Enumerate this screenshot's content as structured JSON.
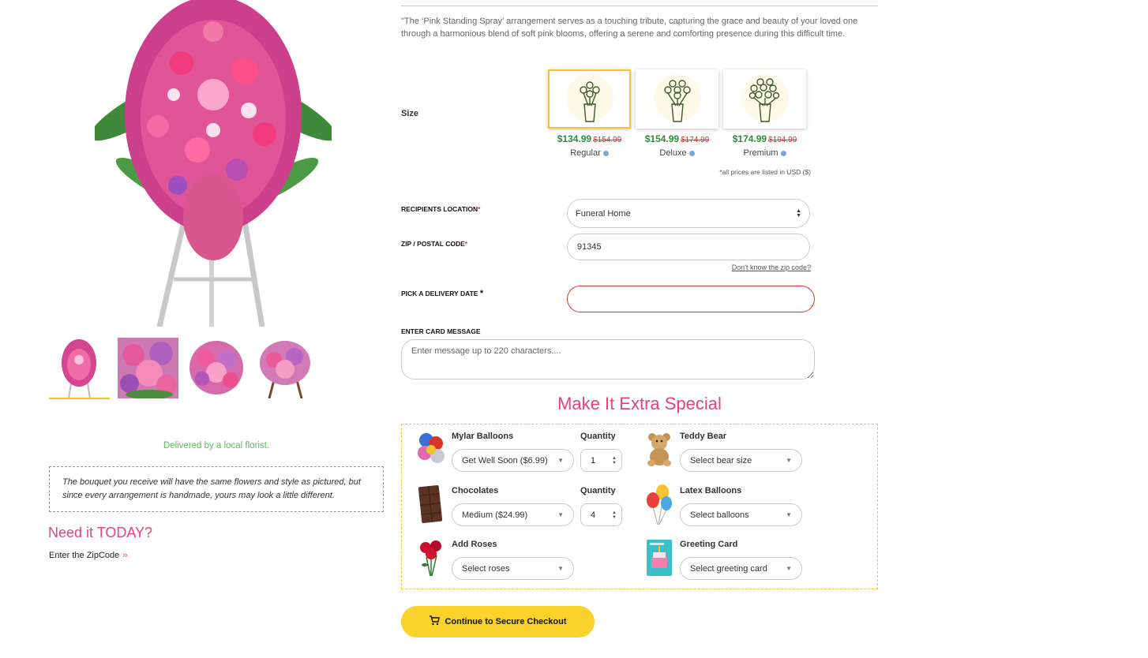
{
  "product": {
    "description": "\"The ‘Pink Standing Spray’ arrangement serves as a touching tribute, capturing the grace and beauty of your loved one through a harmonious blend of soft pink blooms, offering a serene and comforting presence during this difficult time.",
    "delivered_by": "Delivered by a local florist.",
    "disclaimer": "The bouquet you receive will have the same flowers and style as pictured, but since every arrangement is handmade, yours may look a little different.",
    "need_today": "Need it TODAY?",
    "zip_link": "Enter the ZipCode",
    "zip_chevron": "››"
  },
  "size": {
    "label": "Size",
    "options": [
      {
        "price": "$134.99",
        "was": "$154.99",
        "name": "Regular",
        "selected": true
      },
      {
        "price": "$154.99",
        "was": "$174.99",
        "name": "Deluxe",
        "selected": false
      },
      {
        "price": "$174.99",
        "was": "$194.99",
        "name": "Premium",
        "selected": false
      }
    ],
    "note": "*all prices are listed in USD ($)"
  },
  "form": {
    "location_label": "RECIPIENTS LOCATION",
    "location_value": "Funeral Home",
    "zip_label": "ZIP / POSTAL CODE",
    "zip_value": "91345",
    "dont_know": "Don't know the zip code?",
    "date_label": "PICK A DELIVERY DATE",
    "date_value": "",
    "card_label": "ENTER CARD MESSAGE",
    "card_placeholder": "Enter message up to 220 characters....",
    "required_mark": "*"
  },
  "extras": {
    "title": "Make It Extra Special",
    "qty_label": "Quantity",
    "mylar": {
      "title": "Mylar Balloons",
      "value": "Get Well Soon ($6.99)",
      "qty": "1"
    },
    "chocolates": {
      "title": "Chocolates",
      "value": "Medium ($24.99)",
      "qty": "4"
    },
    "roses": {
      "title": "Add Roses",
      "value": "Select roses"
    },
    "teddy": {
      "title": "Teddy Bear",
      "value": "Select bear size"
    },
    "latex": {
      "title": "Latex Balloons",
      "value": "Select balloons"
    },
    "card": {
      "title": "Greeting Card",
      "value": "Select greeting card"
    }
  },
  "checkout": {
    "label": "Continue to Secure Checkout"
  },
  "colors": {
    "accent_pink": "#e5417a",
    "accent_yellow": "#fad22c",
    "price_green": "#2e8b3a",
    "price_red": "#d9342b",
    "florist_green": "#5cb85c"
  },
  "icons": [
    "pink-standing-spray-photo",
    "bouquet-icon",
    "cart-icon",
    "info-icon",
    "chevron-down-icon"
  ]
}
